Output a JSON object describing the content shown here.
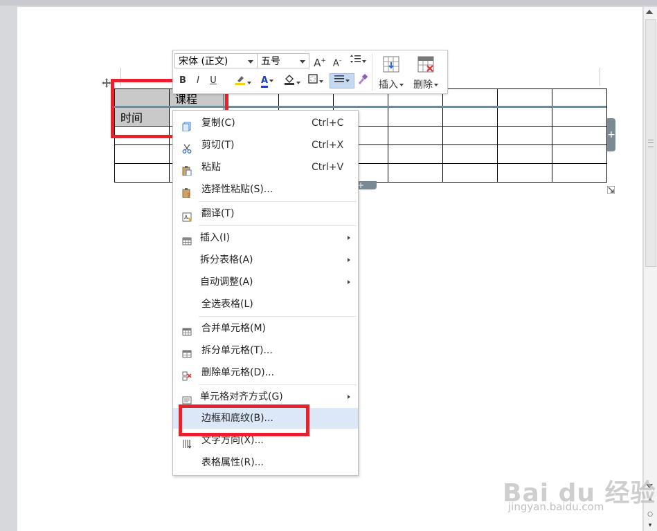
{
  "toolbar": {
    "font_name": "宋体 (正文)",
    "font_size": "五号",
    "grow_font": "A",
    "shrink_font": "A",
    "bold": "B",
    "italic": "I",
    "underline": "U",
    "font_color_letter": "A",
    "insert_label": "插入",
    "delete_label": "删除"
  },
  "table": {
    "header_cell": "课程",
    "row_cell": "时间"
  },
  "menu": {
    "items": [
      {
        "label": "复制(C)",
        "shortcut": "Ctrl+C",
        "icon": "copy-icon"
      },
      {
        "label": "剪切(T)",
        "shortcut": "Ctrl+X",
        "icon": "scissors-icon"
      },
      {
        "label": "粘贴",
        "shortcut": "Ctrl+V",
        "icon": "paste-icon"
      },
      {
        "label": "选择性粘贴(S)...",
        "shortcut": "",
        "icon": "paste-special-icon"
      },
      {
        "label": "翻译(T)",
        "shortcut": "",
        "icon": "translate-icon"
      },
      {
        "label": "插入(I)",
        "shortcut": "",
        "icon": "insert-table-icon"
      },
      {
        "label": "拆分表格(A)",
        "shortcut": "",
        "icon": ""
      },
      {
        "label": "自动调整(A)",
        "shortcut": "",
        "icon": ""
      },
      {
        "label": "全选表格(L)",
        "shortcut": "",
        "icon": ""
      },
      {
        "label": "合并单元格(M)",
        "shortcut": "",
        "icon": "merge-cells-icon"
      },
      {
        "label": "拆分单元格(T)...",
        "shortcut": "",
        "icon": "split-cells-icon"
      },
      {
        "label": "删除单元格(D)...",
        "shortcut": "",
        "icon": "delete-cells-icon"
      },
      {
        "label": "单元格对齐方式(G)",
        "shortcut": "",
        "icon": "cell-align-icon"
      },
      {
        "label": "边框和底纹(B)...",
        "shortcut": "",
        "icon": ""
      },
      {
        "label": "文字方向(X)...",
        "shortcut": "",
        "icon": "text-direction-icon"
      },
      {
        "label": "表格属性(R)...",
        "shortcut": "",
        "icon": ""
      }
    ]
  },
  "watermark": {
    "brand": "Bai du 经验",
    "url": "jingyan.baidu.com"
  },
  "colors": {
    "highlight_box": "#e8222c",
    "menu_hover": "#dce8f7",
    "selected_cell": "#c9c9c9"
  }
}
